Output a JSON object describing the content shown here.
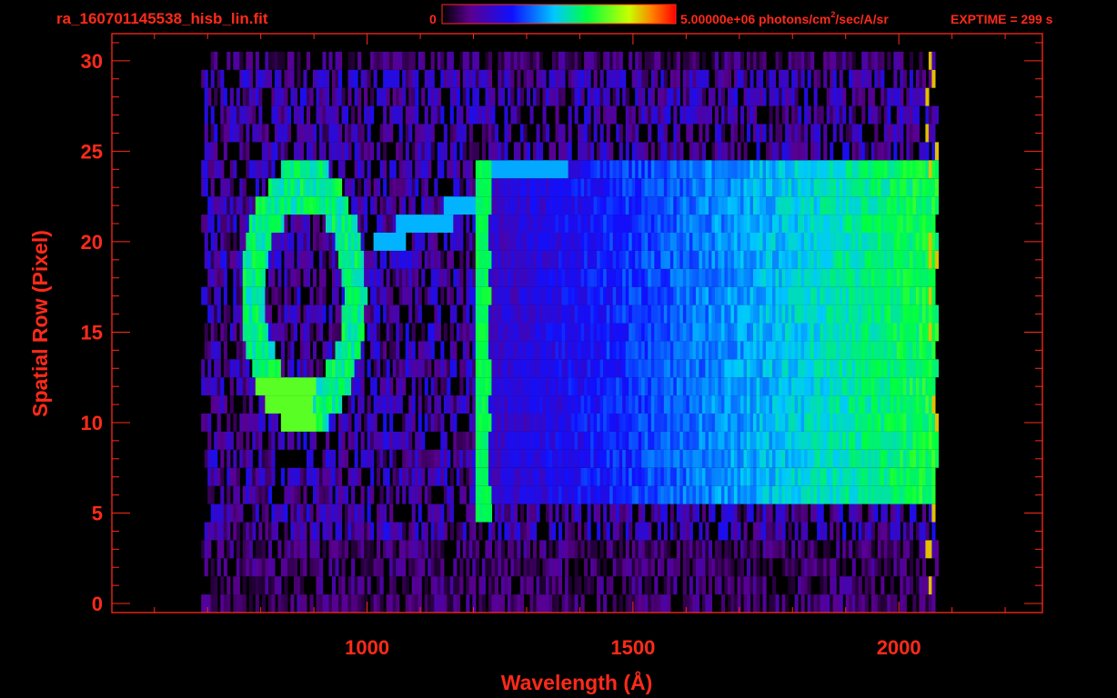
{
  "header": {
    "filename": "ra_160701145538_hisb_lin.fit",
    "colorbar_min": "0",
    "colorbar_max": "5.00000e+06",
    "units_prefix": "photons/cm",
    "units_sup": "2",
    "units_suffix": "/sec/A/sr",
    "exptime": "EXPTIME = 299 s"
  },
  "chart_data": {
    "type": "heatmap",
    "title": "ra_160701145538_hisb_lin.fit",
    "xlabel": "Wavelength (Å)",
    "ylabel": "Spatial Row (Pixel)",
    "xlim": [
      520,
      2270
    ],
    "ylim": [
      -0.5,
      31.5
    ],
    "x_ticks": [
      1000,
      1500,
      2000
    ],
    "y_ticks": [
      0,
      5,
      10,
      15,
      20,
      25,
      30
    ],
    "colorbar": {
      "min": 0,
      "max": 5000000,
      "palette": [
        "#000000",
        "#5a0090",
        "#1010ff",
        "#00c8ff",
        "#00ff40",
        "#c8ff00",
        "#ff8000",
        "#ff0000"
      ]
    },
    "features": {
      "noise_x_range": [
        690,
        2070
      ],
      "noise_rows": [
        3,
        30
      ],
      "detector_edge_x": 2065,
      "loop": {
        "x": [
          770,
          1015
        ],
        "rows": [
          10,
          24
        ]
      },
      "emission_line": {
        "x": 1216,
        "rows": [
          5,
          24
        ]
      },
      "continuum": {
        "x": [
          1200,
          2065
        ],
        "rows": [
          6,
          24
        ]
      },
      "connector": {
        "x": [
          1015,
          1200
        ],
        "rows": [
          20,
          22
        ]
      }
    }
  }
}
